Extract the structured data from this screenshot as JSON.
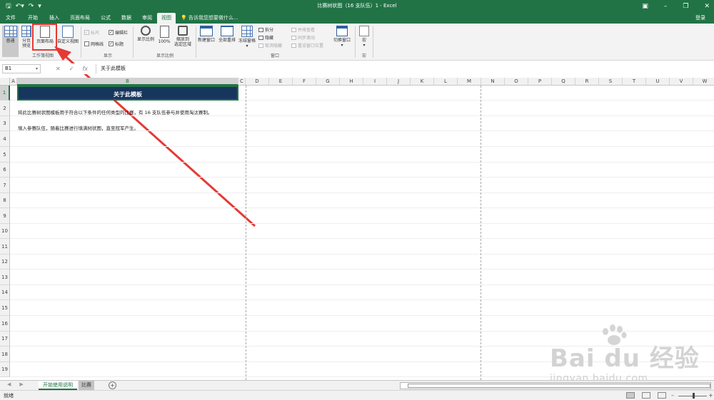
{
  "window": {
    "title": "比赛树状图（16 支队伍）1 - Excel",
    "login": "登录"
  },
  "tabs": [
    "文件",
    "开始",
    "插入",
    "页面布局",
    "公式",
    "数据",
    "审阅",
    "视图"
  ],
  "active_tab": "视图",
  "tell_me": "告诉我您想要做什么...",
  "ribbon": {
    "workbook_views": {
      "label": "工作簿视图",
      "normal": "普通",
      "page_break_1": "分页",
      "page_break_2": "预览",
      "page_layout": "页面布局",
      "custom_views": "自定义视图"
    },
    "show": {
      "label": "显示",
      "ruler": "标尺",
      "formula_bar": "编辑栏",
      "gridlines": "网格线",
      "headings": "标题"
    },
    "zoom": {
      "label": "显示比例",
      "zoom": "显示比例",
      "hundred": "100%",
      "zoom_selection_1": "缩放到",
      "zoom_selection_2": "选定区域"
    },
    "window": {
      "label": "窗口",
      "new_window": "新建窗口",
      "arrange_all": "全部重排",
      "freeze_panes": "冻结窗格",
      "split": "拆分",
      "hide": "隐藏",
      "unhide": "取消隐藏",
      "side_by_side": "并排查看",
      "sync_scroll": "同步滚动",
      "reset_position": "重设窗口位置",
      "switch_windows": "切换窗口"
    },
    "macros": {
      "label": "宏",
      "macros": "宏"
    }
  },
  "formula_bar": {
    "name_box": "B1",
    "content": "关于此模板"
  },
  "columns": [
    "A",
    "B",
    "C",
    "D",
    "E",
    "F",
    "G",
    "H",
    "I",
    "J",
    "K",
    "L",
    "M",
    "N",
    "O",
    "P",
    "Q",
    "R",
    "S",
    "T",
    "U",
    "V",
    "W"
  ],
  "rows": [
    "1",
    "2",
    "3",
    "4",
    "5",
    "6",
    "7",
    "8",
    "9",
    "10",
    "11",
    "12",
    "13",
    "14",
    "15",
    "16",
    "17",
    "18",
    "19"
  ],
  "cells": {
    "banner": "关于此模板",
    "row2": "将此比赛树状图模板用于符合以下条件的任何类型的比赛，有 16 支队伍参与并使用淘汰赛制。",
    "row3": "填入参赛队伍，随着比赛进行填满树状图，直至冠军产生。"
  },
  "sheets": [
    "开始使用说明",
    "比赛"
  ],
  "active_sheet": "开始使用说明",
  "status": "就绪",
  "watermark": {
    "logo": "Bai du 经验",
    "url": "jingyan.baidu.com"
  },
  "colors": {
    "excel_green": "#217346",
    "banner_navy": "#17365d",
    "highlight_red": "#e53935"
  }
}
